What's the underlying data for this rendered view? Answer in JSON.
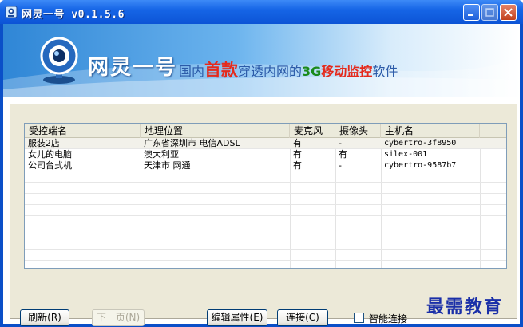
{
  "window": {
    "title": "网灵一号 v0.1.5.6"
  },
  "banner": {
    "brand": "网灵一号",
    "slogan_pre": "国内",
    "slogan_first": "首款",
    "slogan_mid": "穿透内网的",
    "slogan_3g": "3G",
    "slogan_mobile": "移动监控",
    "slogan_post": "软件"
  },
  "table": {
    "columns": [
      "受控端名",
      "地理位置",
      "麦克风",
      "摄像头",
      "主机名"
    ],
    "rows": [
      [
        "服装2店",
        "广东省深圳市 电信ADSL",
        "有",
        "-",
        "cybertro-3f8950"
      ],
      [
        "女儿的电脑",
        "澳大利亚",
        "有",
        "有",
        "silex-001"
      ],
      [
        "公司台式机",
        "天津市 网通",
        "有",
        "-",
        "cybertro-9587b7"
      ]
    ]
  },
  "buttons": {
    "refresh": "刷新(R)",
    "next_page": "下一页(N)",
    "edit_props": "编辑属性(E)",
    "connect": "连接(C)",
    "smart_connect": "智能连接"
  },
  "smart_connect_checked": false,
  "watermark": "最需教育"
}
